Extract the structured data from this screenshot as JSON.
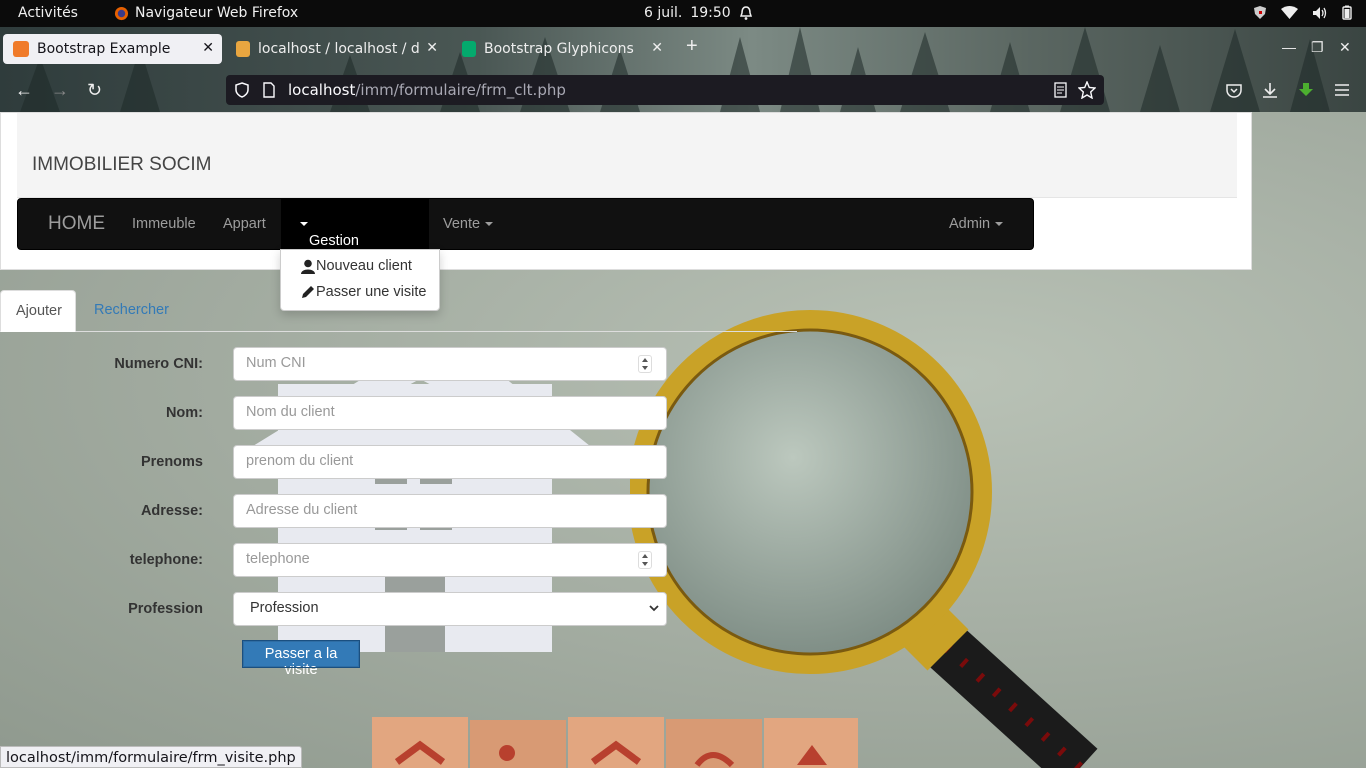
{
  "topbar": {
    "activities": "Activités",
    "app_name": "Navigateur Web Firefox",
    "date": "6 juil.",
    "time": "19:50"
  },
  "browser": {
    "tabs": [
      {
        "label": "Bootstrap Example",
        "active": true
      },
      {
        "label": "localhost / localhost / db",
        "active": false
      },
      {
        "label": "Bootstrap Glyphicons",
        "active": false
      }
    ],
    "url_host": "localhost",
    "url_path": "/imm/formulaire/frm_clt.php",
    "status_url": "localhost/imm/formulaire/frm_visite.php"
  },
  "site": {
    "title": "IMMOBILIER SOCIM",
    "nav": {
      "brand": "HOME",
      "items": [
        "Immeuble",
        "Appart",
        "Gestion du client",
        "Vente"
      ],
      "right": "Admin"
    },
    "dropdown": [
      "Nouveau client",
      "Passer une visite"
    ],
    "tabs": [
      "Ajouter",
      "Rechercher"
    ],
    "form": {
      "fields": [
        {
          "label": "Numero CNI:",
          "placeholder": "Num CNI"
        },
        {
          "label": "Nom:",
          "placeholder": "Nom du client"
        },
        {
          "label": "Prenoms",
          "placeholder": "prenom du client"
        },
        {
          "label": "Adresse:",
          "placeholder": "Adresse du client"
        },
        {
          "label": "telephone:",
          "placeholder": "telephone"
        },
        {
          "label": "Profession",
          "placeholder": "Profession"
        }
      ],
      "submit": "Passer a la visite"
    }
  },
  "colors": {
    "navbar": "#111111",
    "link": "#337ab7",
    "button": "#337ab7"
  }
}
